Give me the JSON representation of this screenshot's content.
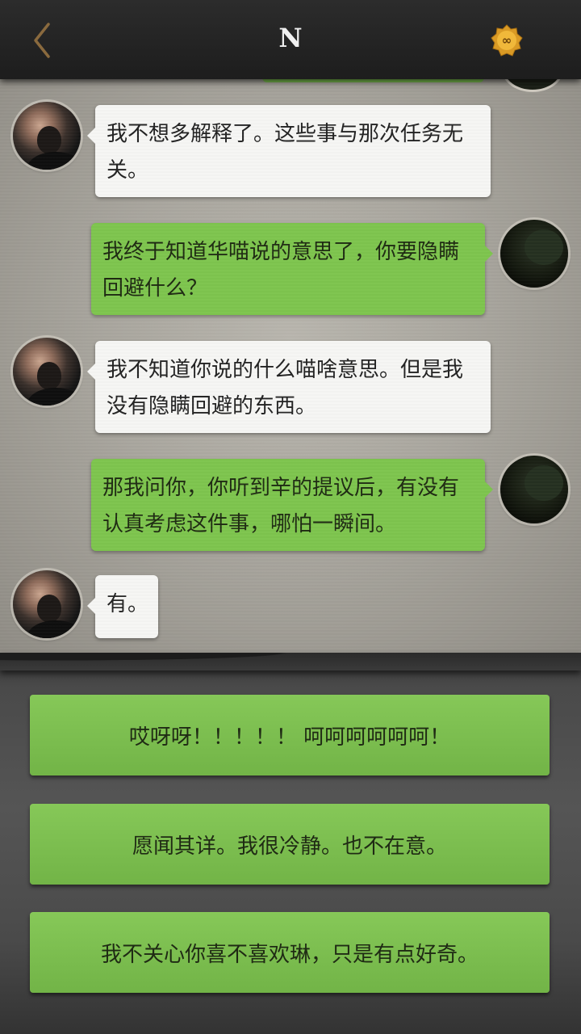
{
  "header": {
    "title": "N",
    "back_icon": "chevron-left-icon",
    "badge_icon": "infinity-badge-icon",
    "badge_symbol": "∞",
    "back_color": "#8a6a3e",
    "badge_color": "#e0a12a"
  },
  "messages": [
    {
      "sender": "npc",
      "text": "我不想多解释了。这些事与那次任务无关。"
    },
    {
      "sender": "player",
      "text": "我终于知道华喵说的意思了，你要隐瞒回避什么？"
    },
    {
      "sender": "npc",
      "text": "我不知道你说的什么喵啥意思。但是我没有隐瞒回避的东西。"
    },
    {
      "sender": "player",
      "text": "那我问你，你听到辛的提议后，有没有认真考虑这件事，哪怕一瞬间。"
    },
    {
      "sender": "npc",
      "text": "有。"
    }
  ],
  "options": [
    {
      "label": "哎呀呀！！！！！ 呵呵呵呵呵呵！"
    },
    {
      "label": "愿闻其详。我很冷静。也不在意。"
    },
    {
      "label": "我不关心你喜不喜欢琳，只是有点好奇。"
    }
  ],
  "colors": {
    "player_bubble": "#7ec54e",
    "npc_bubble": "#f6f6f4",
    "option_button": "#7cbf50"
  }
}
